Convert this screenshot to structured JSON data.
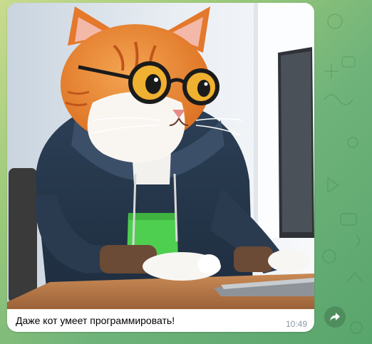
{
  "message": {
    "image_alt": "cat in glasses and hoodie at a computer",
    "caption": "Даже кот умеет программировать!",
    "time": "10:49"
  },
  "actions": {
    "forward_icon": "forward-arrow-icon"
  },
  "colors": {
    "bubble": "#ffffff",
    "time_text": "#8d9aa6",
    "wallpaper_start": "#c9db8e",
    "wallpaper_end": "#58a56c"
  }
}
